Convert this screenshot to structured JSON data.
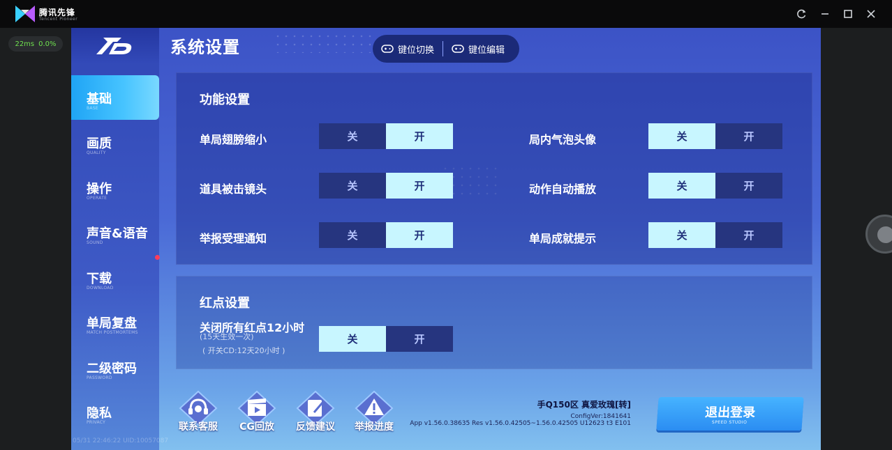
{
  "host": {
    "brand": "腾讯先锋",
    "brand_sub": "Tencent Pioneer",
    "ping": "22ms",
    "loss": "0.0%"
  },
  "page_title": "系统设置",
  "key_buttons": {
    "switch": "键位切换",
    "edit": "键位编辑"
  },
  "nav": [
    {
      "zh": "基础",
      "en": "BASE",
      "active": true
    },
    {
      "zh": "画质",
      "en": "QUALITY"
    },
    {
      "zh": "操作",
      "en": "OPERATE"
    },
    {
      "zh": "声音&语音",
      "en": "SOUND"
    },
    {
      "zh": "下载",
      "en": "DOWNLOAD"
    },
    {
      "zh": "单局复盘",
      "en": "MATCH POSTMORTEMS"
    },
    {
      "zh": "二级密码",
      "en": "PASSWORD"
    },
    {
      "zh": "隐私",
      "en": "PRIVACY"
    }
  ],
  "function_settings": {
    "title": "功能设置",
    "off_label": "关",
    "on_label": "开",
    "left": [
      {
        "label": "单局翅膀缩小",
        "selected": "on"
      },
      {
        "label": "道具被击镜头",
        "selected": "on"
      },
      {
        "label": "举报受理通知",
        "selected": "on"
      }
    ],
    "right": [
      {
        "label": "局内气泡头像",
        "selected": "off"
      },
      {
        "label": "动作自动播放",
        "selected": "off"
      },
      {
        "label": "单局成就提示",
        "selected": "off"
      }
    ]
  },
  "reddot_settings": {
    "title": "红点设置",
    "label": "关闭所有红点12小时",
    "sub1": "(15天生效一次)",
    "sub2": "( 开关CD:12天20小时 )",
    "selected": "off"
  },
  "bottom_buttons": [
    "联系客服",
    "CG回放",
    "反馈建议",
    "举报进度"
  ],
  "account": {
    "name": "手Q150区 真爱玫瑰[转]",
    "config": "ConfigVer:1841641",
    "version": "App v1.56.0.38635 Res v1.56.0.42505~1.56.0.42505 U12623 t3 E101"
  },
  "logout": {
    "label": "退出登录",
    "sub": "SPEED STUDIO"
  },
  "footer_timestamp": "05/31 22:46:22 UID:10057087",
  "colors": {
    "toggle_on": "#c8f6ff",
    "toggle_off": "#26357f",
    "accent": "#2b8df2"
  }
}
